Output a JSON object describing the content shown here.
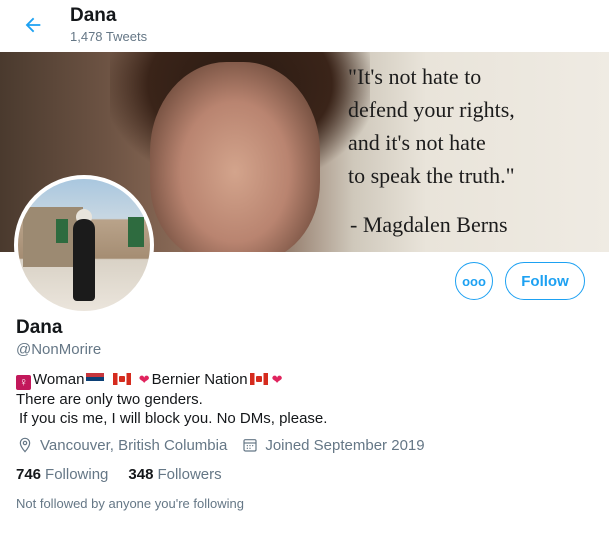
{
  "header": {
    "name": "Dana",
    "tweet_count": "1,478 Tweets",
    "back_icon": "arrow-left-icon"
  },
  "banner": {
    "quote_lines": [
      "\"It's not hate to",
      "defend your rights,",
      "and it's not hate",
      "to speak the truth.\""
    ],
    "author": "- Magdalen Berns"
  },
  "actions": {
    "more_label": "ooo",
    "follow_label": "Follow",
    "accent_color": "#1da1f2"
  },
  "profile": {
    "name": "Dana",
    "handle": "@NonMorire",
    "bio": {
      "line1_a": "Woman",
      "line1_b": "Bernier Nation",
      "line2": "There are only two genders.",
      "line3": "If you cis me, I will block you.  No DMs, please."
    },
    "location": "Vancouver, British Columbia",
    "joined": "Joined September 2019",
    "following_count": "746",
    "following_label": "Following",
    "followers_count": "348",
    "followers_label": "Followers",
    "not_followed": "Not followed by anyone you're following"
  },
  "colors": {
    "text_primary": "#14171a",
    "text_secondary": "#657786"
  }
}
